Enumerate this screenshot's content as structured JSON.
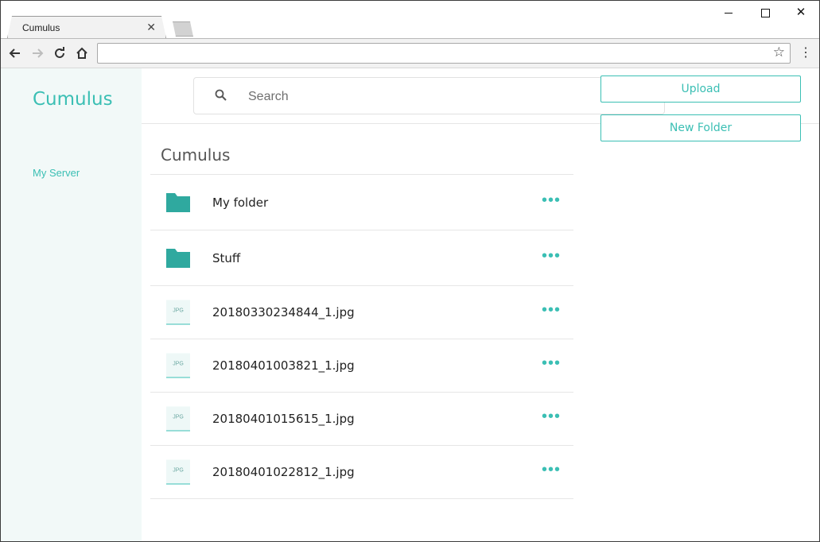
{
  "browser": {
    "tab_title": "Cumulus",
    "tab_close": "✕",
    "address": "",
    "icons": [
      "back-arrow-icon",
      "forward-arrow-icon",
      "reload-icon",
      "home-icon",
      "star-icon",
      "menu-dots-icon"
    ]
  },
  "window_controls": {
    "close": "✕"
  },
  "sidebar": {
    "brand": "Cumulus",
    "items": [
      {
        "label": "My Server"
      }
    ]
  },
  "header": {
    "search_placeholder": "Search"
  },
  "main": {
    "title": "Cumulus",
    "rows": [
      {
        "type": "folder",
        "name": "My folder"
      },
      {
        "type": "folder",
        "name": "Stuff"
      },
      {
        "type": "file",
        "name": "20180330234844_1.jpg",
        "badge": "JPG"
      },
      {
        "type": "file",
        "name": "20180401003821_1.jpg",
        "badge": "JPG"
      },
      {
        "type": "file",
        "name": "20180401015615_1.jpg",
        "badge": "JPG"
      },
      {
        "type": "file",
        "name": "20180401022812_1.jpg",
        "badge": "JPG"
      }
    ],
    "more_label": "•••"
  },
  "actions": {
    "upload_label": "Upload",
    "new_folder_label": "New Folder"
  },
  "colors": {
    "accent": "#3bbfb4",
    "folder": "#2fa99f",
    "sidebar_bg": "#f2f9f8",
    "kebab": "#2d3a8c"
  }
}
